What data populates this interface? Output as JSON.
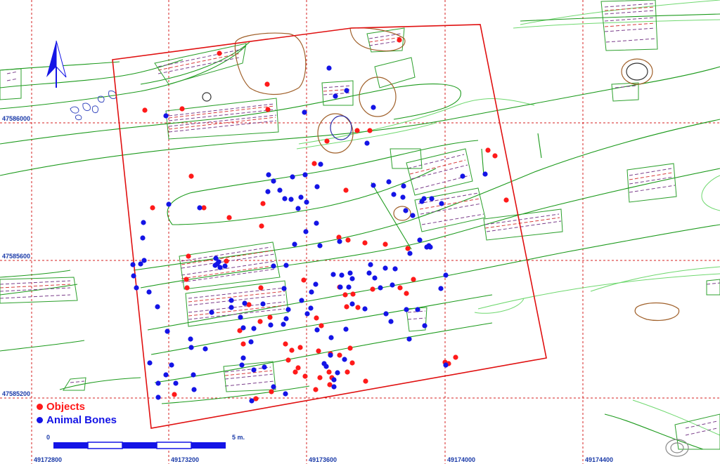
{
  "grid": {
    "x_labels": [
      "49172800",
      "49173200",
      "49173600",
      "49174000",
      "49174400"
    ],
    "y_labels": [
      "47586000",
      "47585600",
      "47585200"
    ]
  },
  "legend": {
    "objects": {
      "label": "Objects",
      "color": "#ff1a1a"
    },
    "bones": {
      "label": "Animal Bones",
      "color": "#1414e6"
    }
  },
  "scale": {
    "start_label": "0",
    "end_label": "5 m."
  },
  "north_arrow": {
    "icon": "north-arrow-icon"
  },
  "colors": {
    "grid": "#d42020",
    "contours": "#2ca02c",
    "light_contours": "#6fd86f",
    "excavation_boundary": "#e01010",
    "pits": "#a0602a",
    "scale_bar": "#1414e6"
  }
}
